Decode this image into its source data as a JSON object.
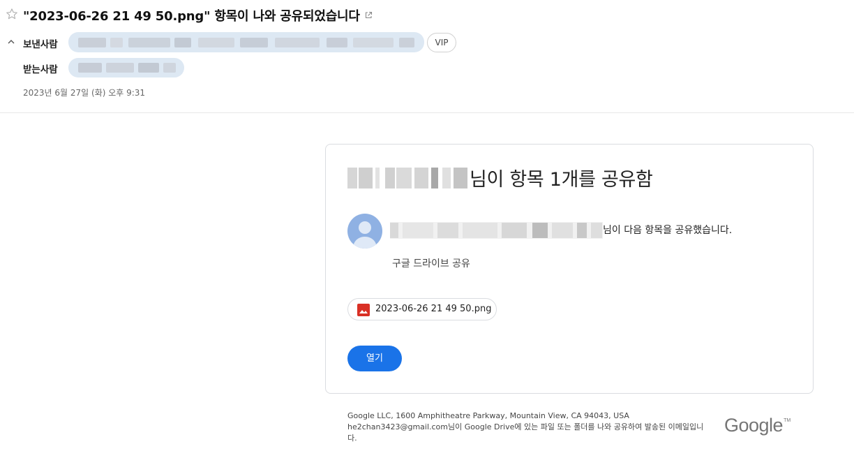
{
  "mail": {
    "subject": "\"2023-06-26 21 49 50.png\" 항목이 나와 공유되었습니다",
    "from_label": "보낸사람",
    "to_label": "받는사람",
    "vip_label": "VIP",
    "date": "2023년 6월 27일 (화) 오후 9:31"
  },
  "card": {
    "title": "님이 항목 1개를 공유함",
    "sender_suffix": "님이 다음 항목을 공유했습니다.",
    "share_note": "구글 드라이브 공유",
    "file_name": "2023-06-26 21 49 50.png",
    "open_label": "열기"
  },
  "footer": {
    "address": "Google LLC, 1600 Amphitheatre Parkway, Mountain View, CA 94043, USA",
    "email": "he2chan3423@gmail.com",
    "note_part": "님이 Google Drive에 있는 파일 또는 폴더를 나와 공유하여 발송된 이메일입니다.",
    "logo": "Google",
    "tm": "TM"
  },
  "colors": {
    "accent": "#1a73e8",
    "avatar": "#8fb1e3",
    "image_icon": "#d93025",
    "chip_bg": "#dde8f3"
  },
  "icons": [
    "star-icon",
    "external-link-icon",
    "chevron-up-icon",
    "person-icon",
    "image-icon"
  ]
}
